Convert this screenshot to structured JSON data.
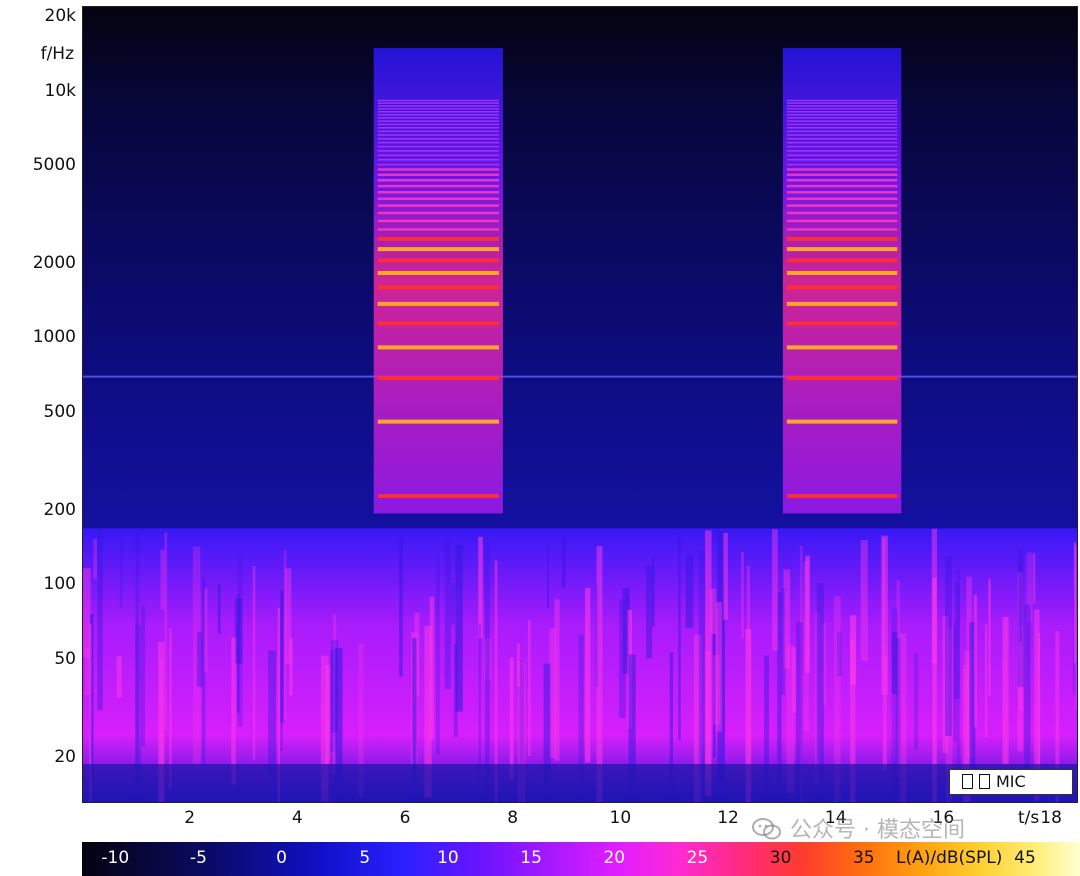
{
  "chart_data": {
    "type": "heatmap",
    "title": "",
    "xlabel": "t/s",
    "ylabel": "f/Hz",
    "x_scale": "linear",
    "y_scale": "log",
    "xlim": [
      0,
      18.5
    ],
    "ylim": [
      13,
      22000
    ],
    "x_ticks": [
      2,
      4,
      6,
      8,
      10,
      12,
      14,
      16,
      18
    ],
    "y_ticks": [
      20,
      50,
      100,
      200,
      500,
      1000,
      2000,
      5000,
      10000,
      20000
    ],
    "y_tick_labels": [
      "20",
      "50",
      "100",
      "200",
      "500",
      "1000",
      "2000",
      "5000",
      "10k",
      "20k"
    ],
    "x_tick_labels": [
      "2",
      "4",
      "6",
      "8",
      "10",
      "12",
      "14",
      "16",
      "18"
    ],
    "legend": {
      "label": "MIC",
      "placement": "bottom-right"
    },
    "colorbar": {
      "label": "L(A)/dB(SPL)",
      "ticks": [
        -10,
        -5,
        0,
        5,
        10,
        15,
        20,
        25,
        30,
        35,
        45
      ],
      "range": [
        -12,
        48
      ]
    },
    "harmonic_events": [
      {
        "t_start": 5.4,
        "t_end": 7.8,
        "f0": 230,
        "f_max": 15000
      },
      {
        "t_start": 13.0,
        "t_end": 15.2,
        "f0": 230,
        "f_max": 15000
      }
    ],
    "background_noise_band": {
      "f_low": 13,
      "f_high": 170,
      "level_db": 12
    },
    "tonal_line_hz": 700
  },
  "watermark": {
    "text": "公众号 · 模态空间"
  },
  "colors": {
    "background": "#04030f",
    "low": "#1010c8",
    "mid": "#e21eff",
    "high": "#ff6c10",
    "peak": "#ffffd0"
  }
}
